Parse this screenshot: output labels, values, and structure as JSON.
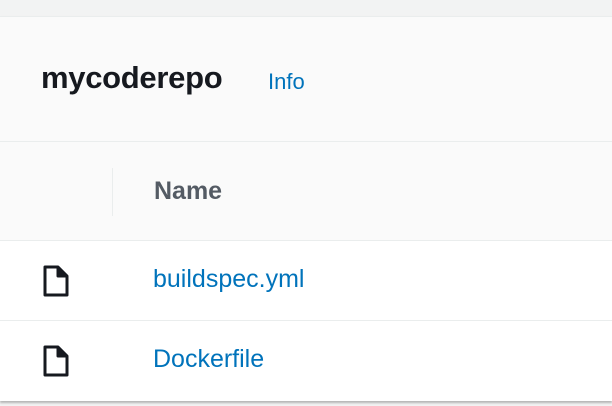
{
  "header": {
    "title": "mycoderepo",
    "info_label": "Info"
  },
  "table": {
    "columns": [
      "Name"
    ],
    "rows": [
      {
        "name": "buildspec.yml",
        "icon": "file-icon"
      },
      {
        "name": "Dockerfile",
        "icon": "file-icon"
      }
    ]
  },
  "colors": {
    "link": "#0073bb",
    "title": "#16191f",
    "header_text": "#545b64",
    "border": "#eaeded"
  }
}
